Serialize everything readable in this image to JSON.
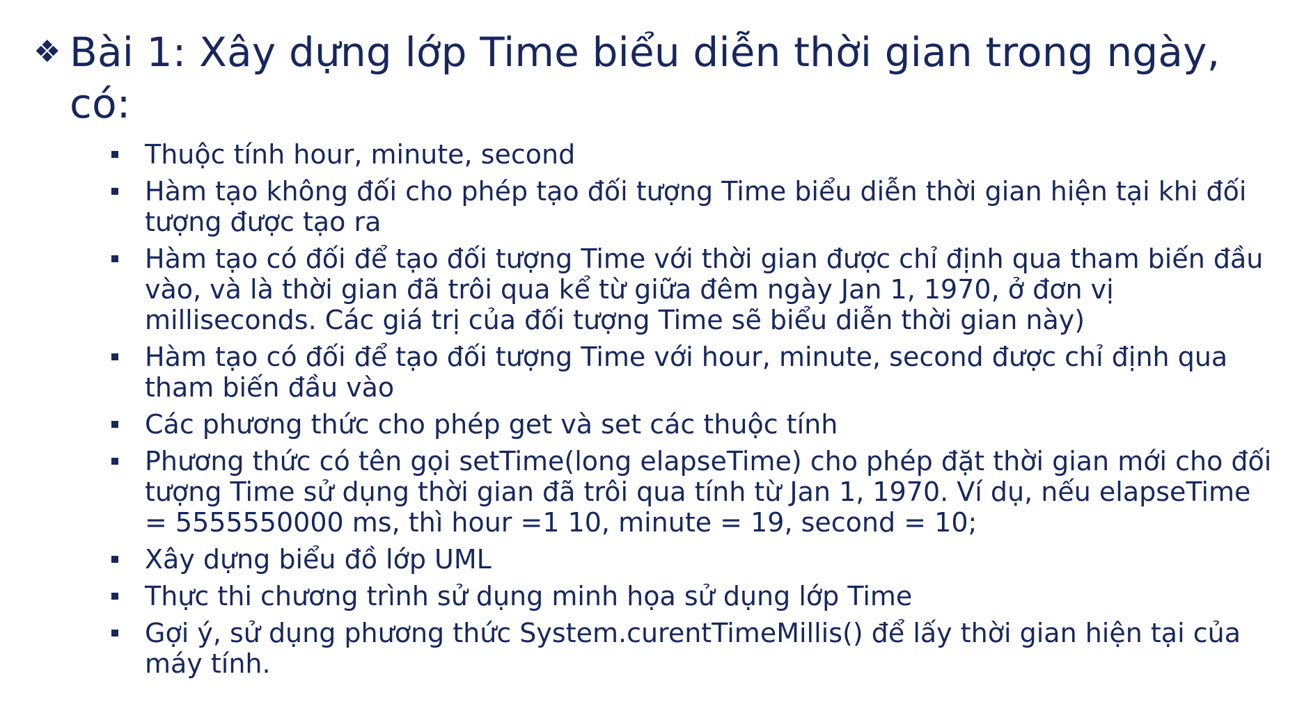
{
  "title": {
    "bullet_icon": "diamond-bullet-icon",
    "text": "Bài 1: Xây dựng lớp Time biểu diễn thời gian trong ngày, có:"
  },
  "items": [
    {
      "text": "Thuộc tính hour, minute, second"
    },
    {
      "text": "Hàm tạo không đối cho phép tạo đối tượng Time biểu diễn thời gian hiện tại khi đối tượng được tạo ra"
    },
    {
      "text": "Hàm tạo có đối để tạo đối tượng Time với thời gian được chỉ định qua tham biến đầu vào, và là thời gian đã trôi qua kể từ giữa đêm ngày Jan 1, 1970, ở đơn vị milliseconds. Các giá trị của đối tượng Time sẽ biểu diễn thời gian này)"
    },
    {
      "text": "Hàm tạo có đối để tạo đối tượng Time với hour, minute, second được chỉ định qua tham biến đầu vào"
    },
    {
      "text": "Các phương thức cho phép get và set các thuộc tính"
    },
    {
      "text": "Phương thức có tên gọi setTime(long elapseTime) cho phép đặt thời gian mới cho đối tượng Time sử dụng thời gian đã trôi qua tính từ Jan 1, 1970. Ví dụ, nếu elapseTime = 5555550000 ms, thì hour =1 10, minute = 19, second = 10;"
    },
    {
      "text": "Xây dựng biểu đồ lớp UML"
    },
    {
      "text": "Thực thi chương trình sử dụng minh họa sử dụng lớp Time"
    },
    {
      "text": "Gợi ý, sử dụng phương thức System.curentTimeMillis() để lấy thời gian hiện tại của máy tính."
    }
  ],
  "colors": {
    "text": "#17275e",
    "background": "#ffffff"
  }
}
